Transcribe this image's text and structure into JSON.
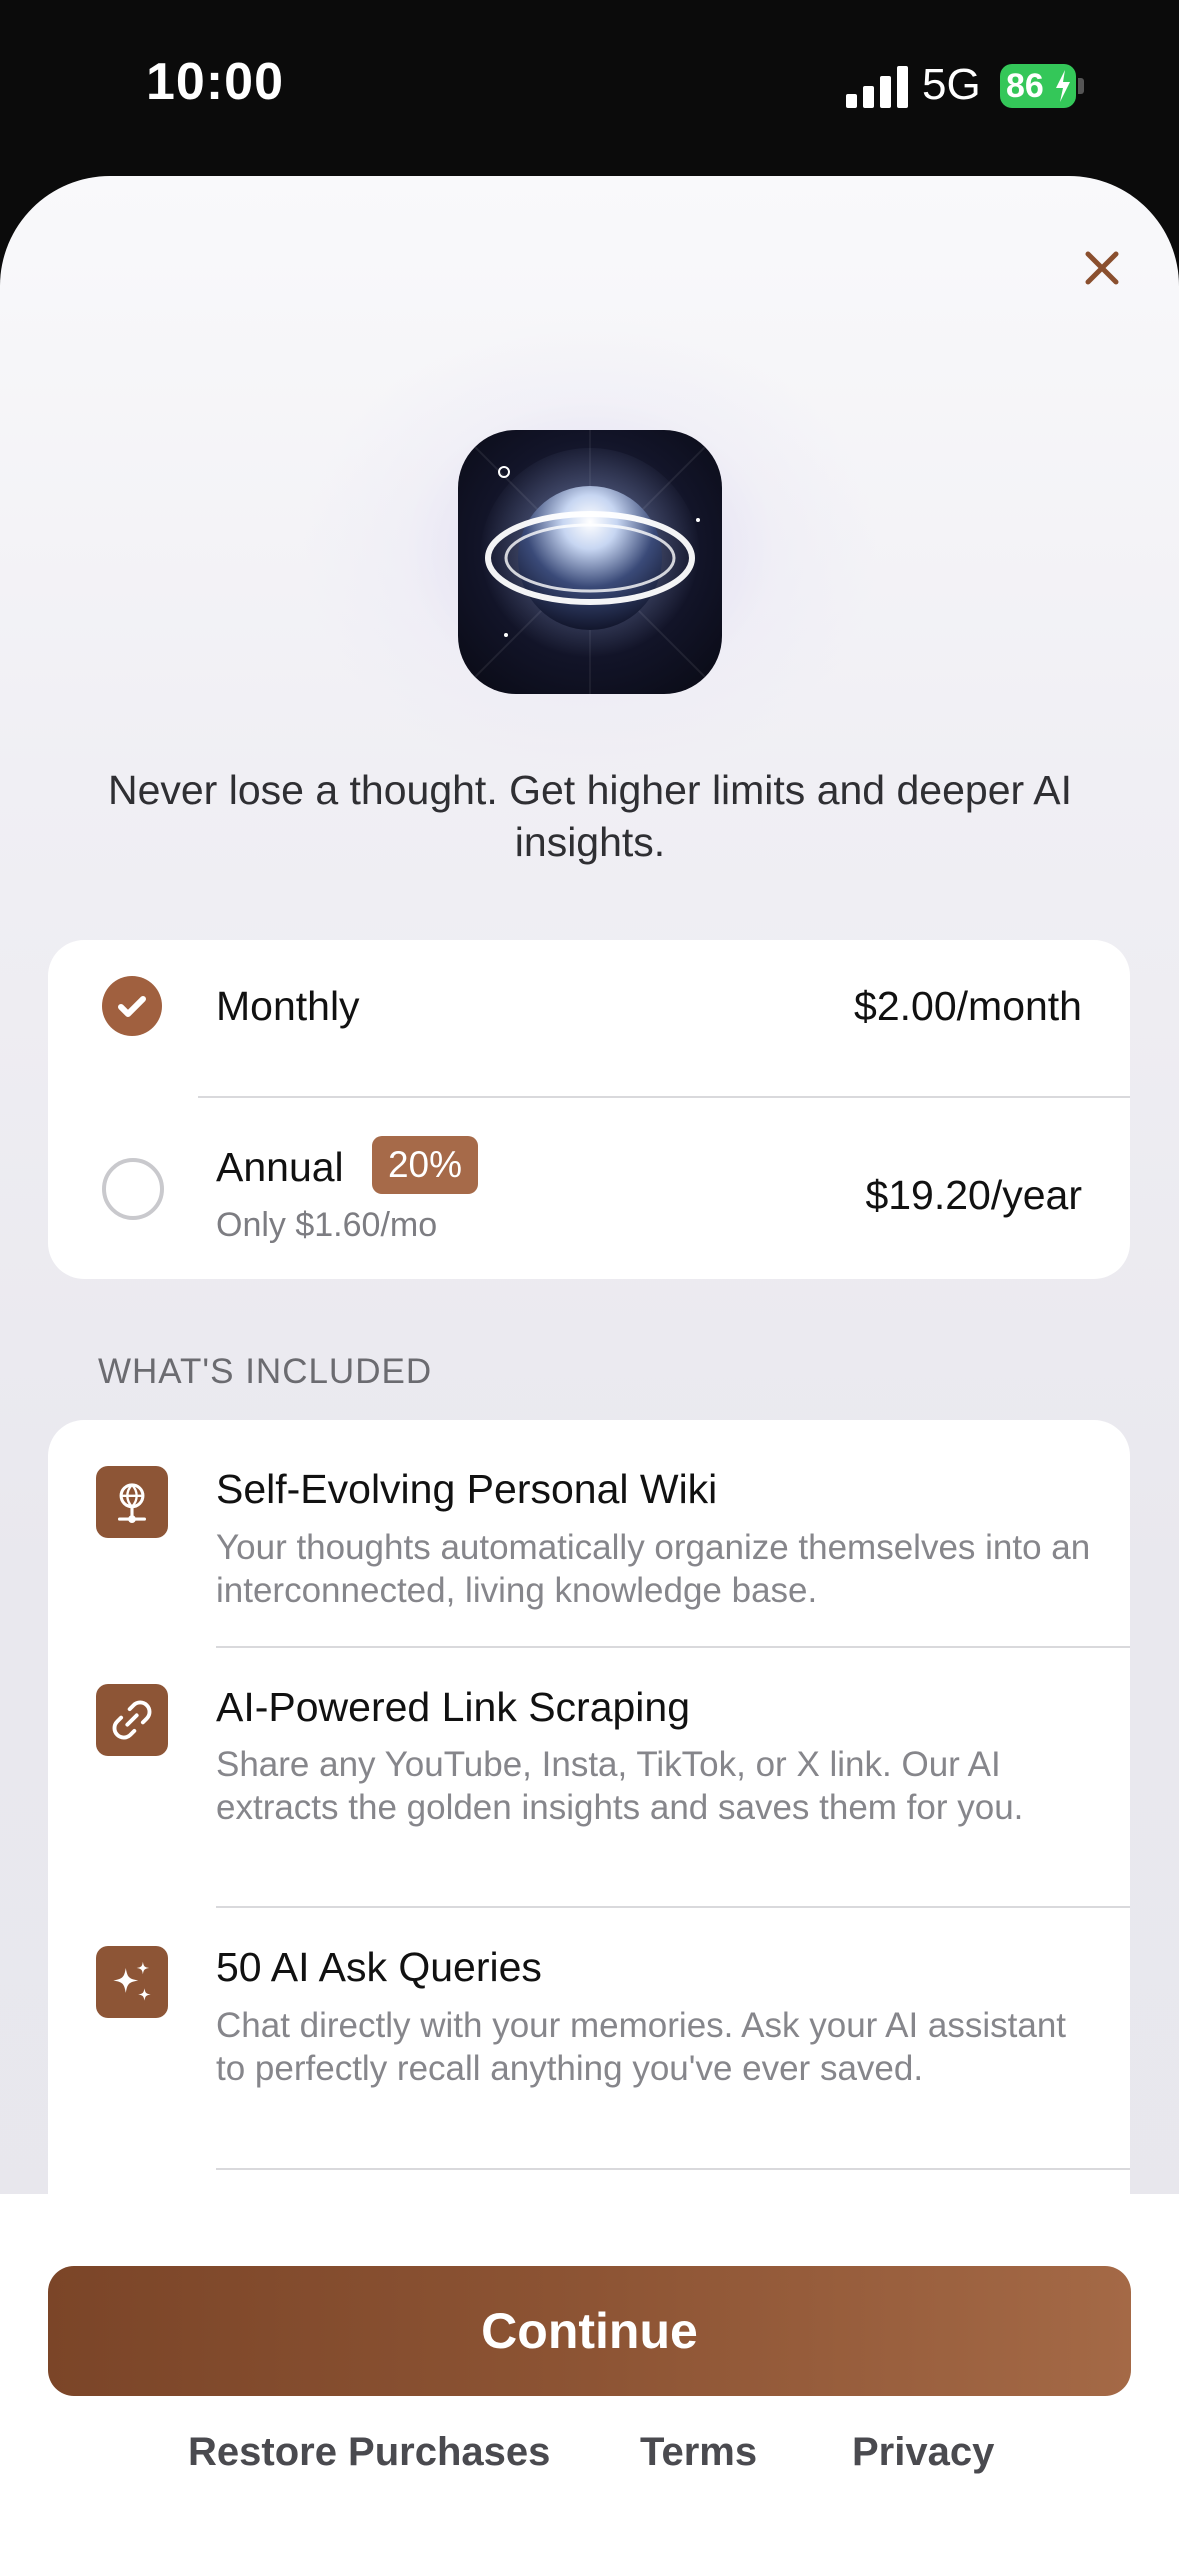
{
  "status_bar": {
    "time": "10:00",
    "network": "5G",
    "battery": "86"
  },
  "close_icon": "close-icon",
  "app_icon": "planet-app-icon",
  "tagline": "Never lose a thought. Get higher limits and deeper AI insights.",
  "plans": [
    {
      "name": "Monthly",
      "price": "$2.00/month",
      "selected": true
    },
    {
      "name": "Annual",
      "badge": "20%",
      "subtitle": "Only $1.60/mo",
      "price": "$19.20/year",
      "selected": false
    }
  ],
  "section_title": "WHAT'S INCLUDED",
  "features": [
    {
      "icon": "wiki-icon",
      "title": "Self-Evolving Personal Wiki",
      "desc": "Your thoughts automatically organize themselves into an interconnected, living knowledge base."
    },
    {
      "icon": "link-icon",
      "title": "AI-Powered Link Scraping",
      "desc": "Share any YouTube, Insta, TikTok, or X link. Our AI extracts the golden insights and saves them for you."
    },
    {
      "icon": "sparkles-icon",
      "title": "50 AI Ask Queries",
      "desc": "Chat directly with your memories. Ask your AI assistant to perfectly recall anything you've ever saved."
    }
  ],
  "bottom": {
    "continue_label": "Continue",
    "restore_label": "Restore Purchases",
    "terms_label": "Terms",
    "privacy_label": "Privacy"
  },
  "colors": {
    "accent": "#a0603f",
    "badge": "#a66a49",
    "battery": "#34c759"
  }
}
